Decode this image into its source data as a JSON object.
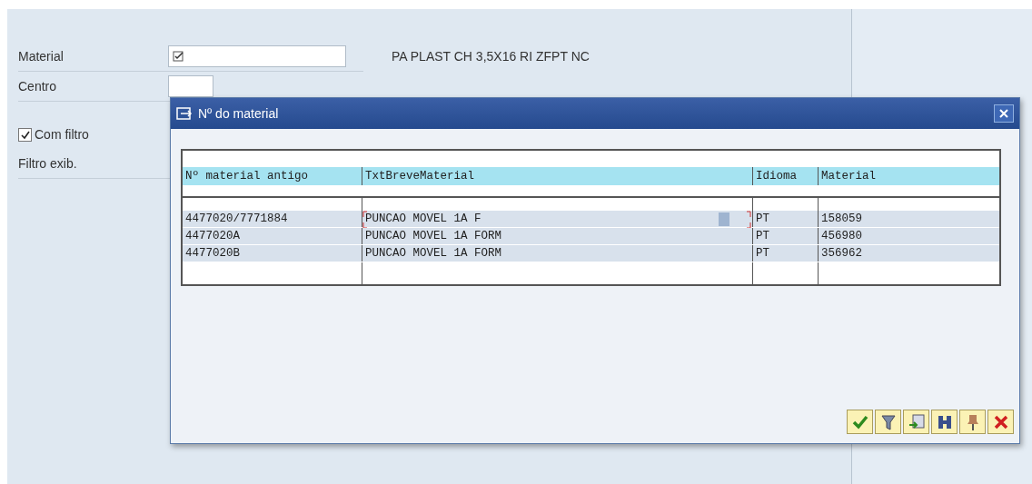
{
  "form": {
    "fields": [
      {
        "label": "Material",
        "kind": "input",
        "required": true,
        "description": "PA PLAST CH 3,5X16 RI ZFPT NC"
      },
      {
        "label": "Centro",
        "kind": "input",
        "required": false
      },
      {
        "label": "Com filtro",
        "kind": "checkbox",
        "checked": true
      },
      {
        "label": "Filtro exib.",
        "kind": "text"
      }
    ]
  },
  "dialog": {
    "title": "Nº do material",
    "table": {
      "columns": [
        "Nº material antigo",
        "TxtBreveMaterial",
        "Idioma",
        "Material"
      ],
      "rows": [
        {
          "cells": [
            "4477020/7771884",
            "PUNCAO MOVEL 1A F",
            "PT",
            "158059"
          ],
          "focused": true
        },
        {
          "cells": [
            "4477020A",
            "PUNCAO MOVEL 1A FORM",
            "PT",
            "456980"
          ],
          "focused": false
        },
        {
          "cells": [
            "4477020B",
            "PUNCAO MOVEL 1A FORM",
            "PT",
            "356962"
          ],
          "focused": false
        }
      ]
    },
    "buttons": [
      {
        "kind": "confirm"
      },
      {
        "kind": "filter"
      },
      {
        "kind": "transfer"
      },
      {
        "kind": "find"
      },
      {
        "kind": "pin"
      },
      {
        "kind": "cancel"
      }
    ]
  }
}
